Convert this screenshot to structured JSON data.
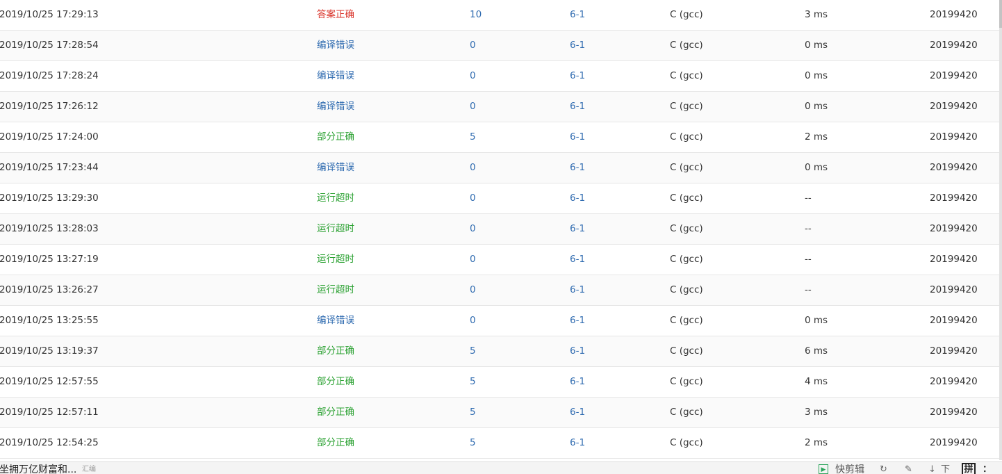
{
  "rows": [
    {
      "time": "2019/10/25 17:29:13",
      "status": "答案正确",
      "status_type": "accepted",
      "score": "10",
      "problem": "6-1",
      "compiler": "C (gcc)",
      "time_used": "3 ms",
      "user": "20199420"
    },
    {
      "time": "2019/10/25 17:28:54",
      "status": "编译错误",
      "status_type": "compile-error",
      "score": "0",
      "problem": "6-1",
      "compiler": "C (gcc)",
      "time_used": "0 ms",
      "user": "20199420"
    },
    {
      "time": "2019/10/25 17:28:24",
      "status": "编译错误",
      "status_type": "compile-error",
      "score": "0",
      "problem": "6-1",
      "compiler": "C (gcc)",
      "time_used": "0 ms",
      "user": "20199420"
    },
    {
      "time": "2019/10/25 17:26:12",
      "status": "编译错误",
      "status_type": "compile-error",
      "score": "0",
      "problem": "6-1",
      "compiler": "C (gcc)",
      "time_used": "0 ms",
      "user": "20199420"
    },
    {
      "time": "2019/10/25 17:24:00",
      "status": "部分正确",
      "status_type": "partial",
      "score": "5",
      "problem": "6-1",
      "compiler": "C (gcc)",
      "time_used": "2 ms",
      "user": "20199420"
    },
    {
      "time": "2019/10/25 17:23:44",
      "status": "编译错误",
      "status_type": "compile-error",
      "score": "0",
      "problem": "6-1",
      "compiler": "C (gcc)",
      "time_used": "0 ms",
      "user": "20199420"
    },
    {
      "time": "2019/10/25 13:29:30",
      "status": "运行超时",
      "status_type": "timeout",
      "score": "0",
      "problem": "6-1",
      "compiler": "C (gcc)",
      "time_used": "--",
      "user": "20199420"
    },
    {
      "time": "2019/10/25 13:28:03",
      "status": "运行超时",
      "status_type": "timeout",
      "score": "0",
      "problem": "6-1",
      "compiler": "C (gcc)",
      "time_used": "--",
      "user": "20199420"
    },
    {
      "time": "2019/10/25 13:27:19",
      "status": "运行超时",
      "status_type": "timeout",
      "score": "0",
      "problem": "6-1",
      "compiler": "C (gcc)",
      "time_used": "--",
      "user": "20199420"
    },
    {
      "time": "2019/10/25 13:26:27",
      "status": "运行超时",
      "status_type": "timeout",
      "score": "0",
      "problem": "6-1",
      "compiler": "C (gcc)",
      "time_used": "--",
      "user": "20199420"
    },
    {
      "time": "2019/10/25 13:25:55",
      "status": "编译错误",
      "status_type": "compile-error",
      "score": "0",
      "problem": "6-1",
      "compiler": "C (gcc)",
      "time_used": "0 ms",
      "user": "20199420"
    },
    {
      "time": "2019/10/25 13:19:37",
      "status": "部分正确",
      "status_type": "partial",
      "score": "5",
      "problem": "6-1",
      "compiler": "C (gcc)",
      "time_used": "6 ms",
      "user": "20199420"
    },
    {
      "time": "2019/10/25 12:57:55",
      "status": "部分正确",
      "status_type": "partial",
      "score": "5",
      "problem": "6-1",
      "compiler": "C (gcc)",
      "time_used": "4 ms",
      "user": "20199420"
    },
    {
      "time": "2019/10/25 12:57:11",
      "status": "部分正确",
      "status_type": "partial",
      "score": "5",
      "problem": "6-1",
      "compiler": "C (gcc)",
      "time_used": "3 ms",
      "user": "20199420"
    },
    {
      "time": "2019/10/25 12:54:25",
      "status": "部分正确",
      "status_type": "partial",
      "score": "5",
      "problem": "6-1",
      "compiler": "C (gcc)",
      "time_used": "2 ms",
      "user": "20199420"
    }
  ],
  "colors": {
    "accepted": "#d9342b",
    "compile_error": "#2f6bb0",
    "partial": "#28a02f",
    "timeout": "#28a02f",
    "link": "#2f6bb0"
  },
  "statusbar": {
    "news_text": "坐拥万亿财富和...",
    "source_text": "汇编",
    "clip_icon": "clipboard-icon",
    "clip_label": "快剪辑",
    "icons": [
      "refresh-icon",
      "pin-icon",
      "download-icon"
    ],
    "download_label": "下",
    "ime_label": "拼",
    "ime_extra": "："
  }
}
